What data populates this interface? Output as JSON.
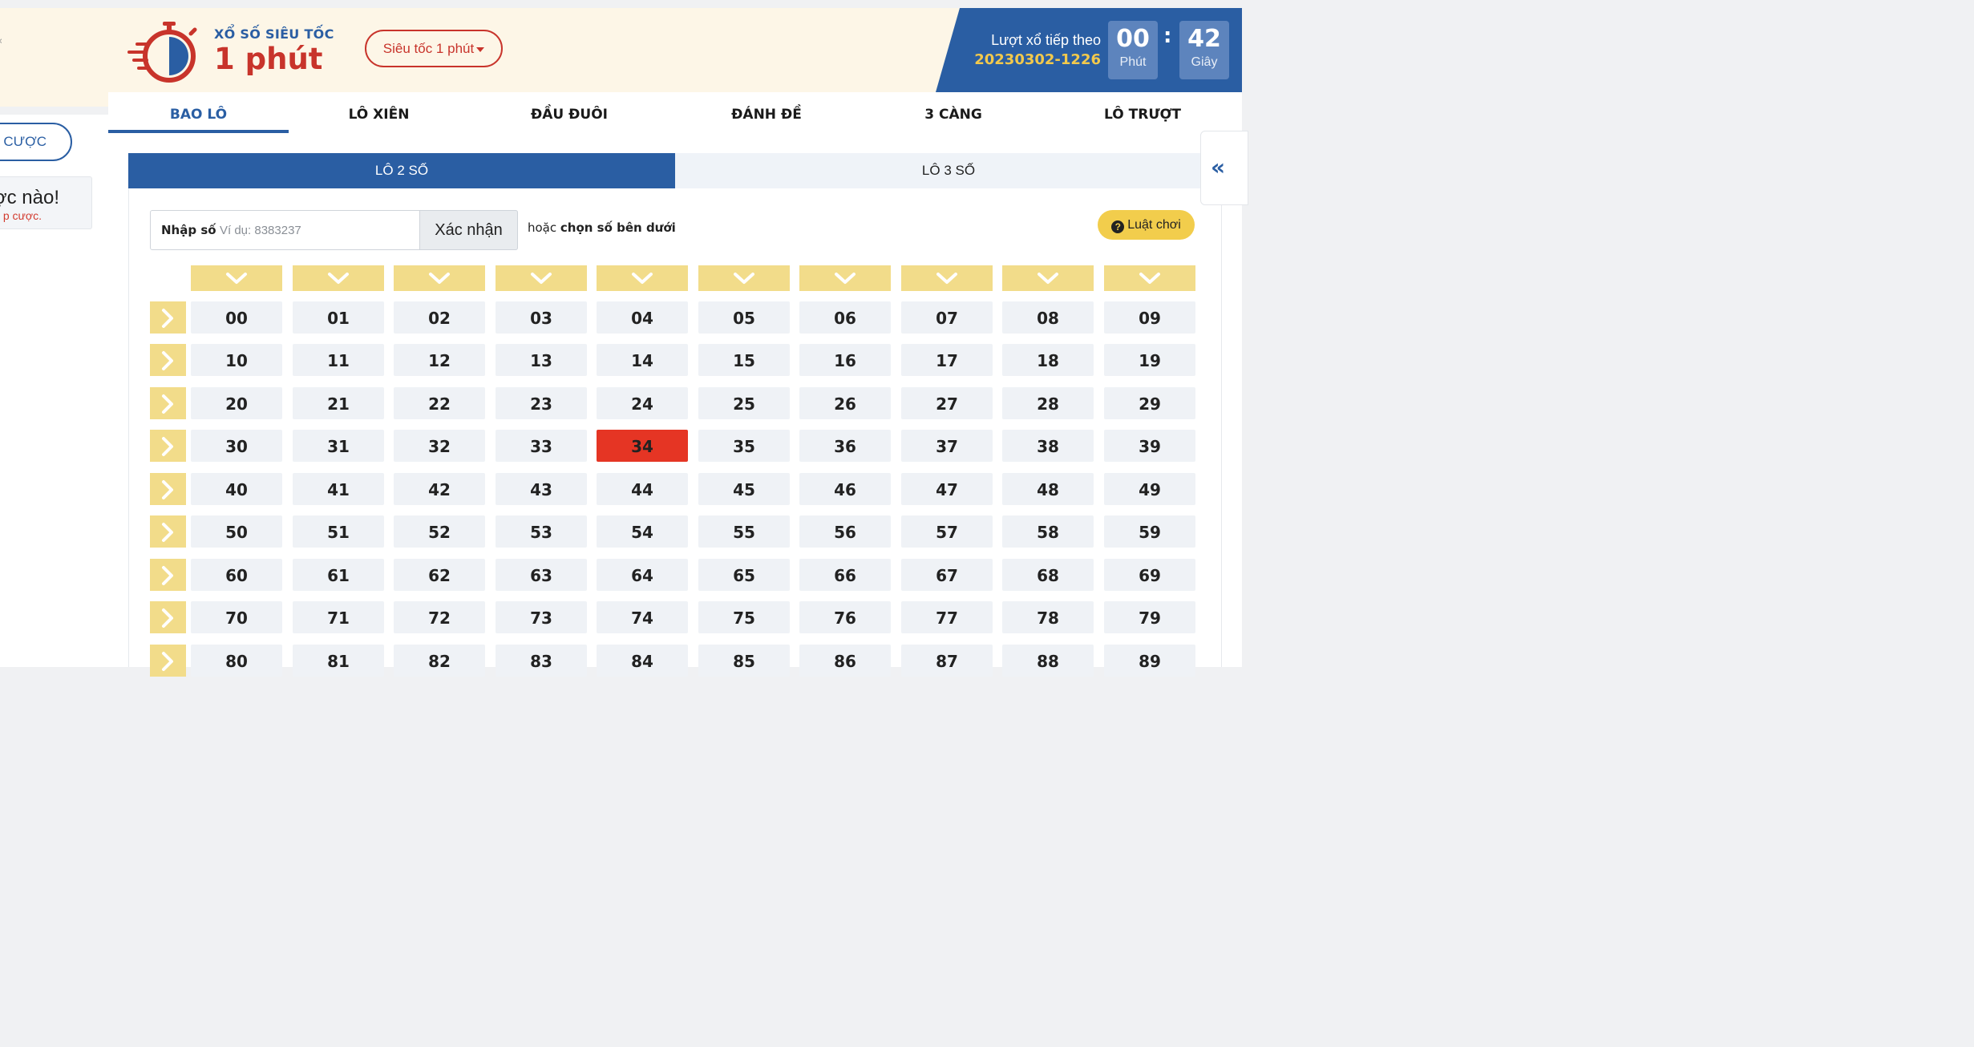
{
  "left_panel": {
    "top_mark": "‹",
    "bet_button_label": "G CƯỢC",
    "empty_title": "ợc nào!",
    "empty_subtitle": "p cược."
  },
  "header": {
    "logo_small": "XỔ SỐ SIÊU TỐC",
    "logo_big": "1 phút",
    "game_select": "Siêu tốc 1 phút",
    "next_label": "Lượt xổ tiếp theo",
    "next_code": "20230302-1226",
    "minutes": "00",
    "minutes_label": "Phút",
    "seconds": "42",
    "seconds_label": "Giây",
    "colon": ":"
  },
  "tabs": [
    "BAO LÔ",
    "LÔ XIÊN",
    "ĐẦU ĐUÔI",
    "ĐÁNH ĐỀ",
    "3 CÀNG",
    "LÔ TRƯỢT"
  ],
  "active_tab": "BAO LÔ",
  "subtabs": [
    "LÔ 2 SỐ",
    "LÔ 3 SỐ"
  ],
  "active_subtab": "LÔ 2 SỐ",
  "input": {
    "label": "Nhập số",
    "placeholder": "Ví dụ: 8383237",
    "value": "",
    "confirm_label": "Xác nhận",
    "or_prefix": "hoặc",
    "or_bold": "chọn số bên dưới"
  },
  "rules_label": "Luật chơi",
  "collapse_label": "«",
  "numbers": [
    [
      "00",
      "01",
      "02",
      "03",
      "04",
      "05",
      "06",
      "07",
      "08",
      "09"
    ],
    [
      "10",
      "11",
      "12",
      "13",
      "14",
      "15",
      "16",
      "17",
      "18",
      "19"
    ],
    [
      "20",
      "21",
      "22",
      "23",
      "24",
      "25",
      "26",
      "27",
      "28",
      "29"
    ],
    [
      "30",
      "31",
      "32",
      "33",
      "34",
      "35",
      "36",
      "37",
      "38",
      "39"
    ],
    [
      "40",
      "41",
      "42",
      "43",
      "44",
      "45",
      "46",
      "47",
      "48",
      "49"
    ],
    [
      "50",
      "51",
      "52",
      "53",
      "54",
      "55",
      "56",
      "57",
      "58",
      "59"
    ],
    [
      "60",
      "61",
      "62",
      "63",
      "64",
      "65",
      "66",
      "67",
      "68",
      "69"
    ],
    [
      "70",
      "71",
      "72",
      "73",
      "74",
      "75",
      "76",
      "77",
      "78",
      "79"
    ],
    [
      "80",
      "81",
      "82",
      "83",
      "84",
      "85",
      "86",
      "87",
      "88",
      "89"
    ]
  ],
  "selected_numbers": [
    "34"
  ],
  "colors": {
    "brand_blue": "#2a5ea3",
    "brand_red": "#c8342b",
    "accent_yellow": "#f2cd4c",
    "selected_red": "#e53524"
  }
}
